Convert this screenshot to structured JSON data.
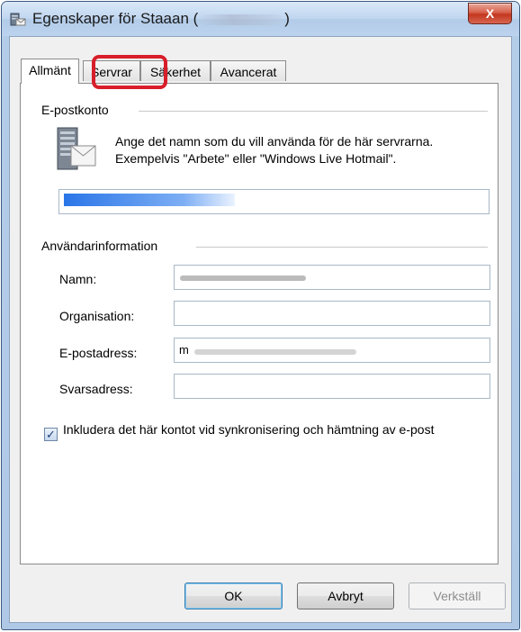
{
  "window": {
    "title_prefix": "Egenskaper för Staaan (",
    "title_suffix": ")",
    "close_glyph": "X"
  },
  "tabs": [
    {
      "label": "Allmänt",
      "active": true
    },
    {
      "label": "Servrar",
      "active": false,
      "highlighted": true
    },
    {
      "label": "Säkerhet",
      "active": false
    },
    {
      "label": "Avancerat",
      "active": false
    }
  ],
  "email_account": {
    "group_label": "E-postkonto",
    "description_line1": "Ange det namn som du vill använda för de här servrarna.",
    "description_line2": "Exempelvis \"Arbete\" eller \"Windows Live Hotmail\".",
    "account_name_value": ""
  },
  "user_info": {
    "group_label": "Användarinformation",
    "fields": [
      {
        "label": "Namn:",
        "value": ""
      },
      {
        "label": "Organisation:",
        "value": ""
      },
      {
        "label": "E-postadress:",
        "value": "m"
      },
      {
        "label": "Svarsadress:",
        "value": ""
      }
    ]
  },
  "sync_option": {
    "label": "Inkludera det här kontot vid synkronisering och hämtning av e-post",
    "checked": true,
    "check_glyph": "✓"
  },
  "buttons": {
    "ok": "OK",
    "cancel": "Avbryt",
    "apply": "Verkställ"
  },
  "colors": {
    "highlight": "#d81e2a",
    "selection": "#1e6ee6"
  }
}
